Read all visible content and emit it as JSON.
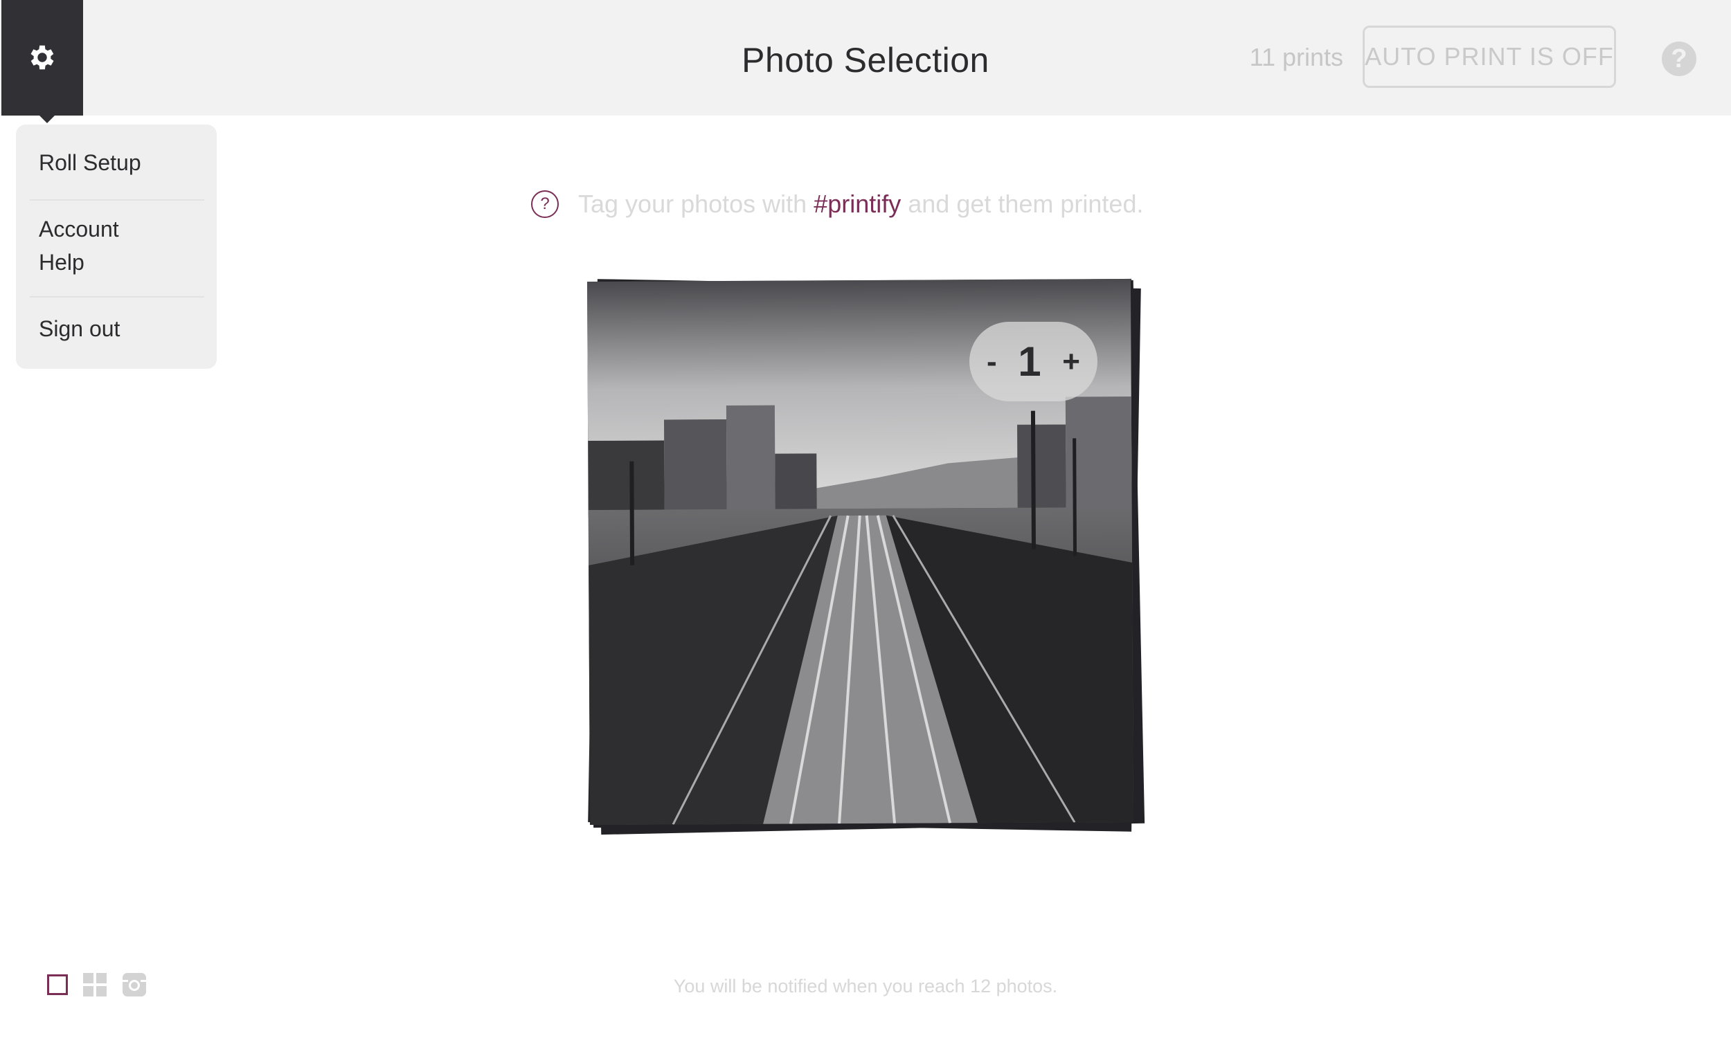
{
  "header": {
    "title": "Photo Selection",
    "print_count": "11 prints",
    "auto_print_label": "AUTO PRINT IS OFF",
    "help_label": "?"
  },
  "settings_menu": {
    "items": [
      "Roll Setup",
      "Account",
      "Help",
      "Sign out"
    ]
  },
  "hint": {
    "icon": "?",
    "before": "Tag your photos with",
    "tag": "#printify",
    "after": "and get them printed."
  },
  "photo": {
    "quantity": "1",
    "minus": "-",
    "plus": "+"
  },
  "footer": {
    "note": "You will be notified when you reach 12 photos."
  },
  "colors": {
    "accent": "#7a2e56",
    "topbar": "#f2f2f2",
    "gear_tab": "#313034"
  },
  "icons": {
    "settings": "gear-icon",
    "view_single": "single-view-icon",
    "view_grid": "grid-view-icon",
    "view_instagram": "instagram-icon"
  }
}
